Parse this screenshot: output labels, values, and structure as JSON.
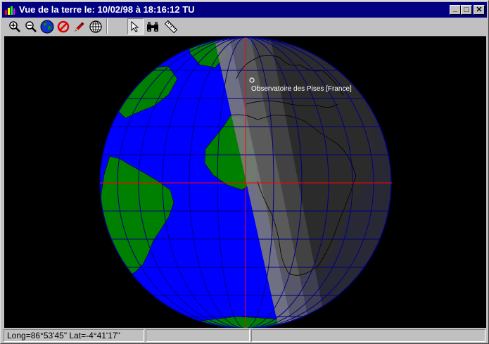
{
  "window": {
    "title": "Vue de la terre le: 10/02/98 à 18:16:12 TU",
    "controls": {
      "minimize": "_",
      "maximize": "□",
      "close": "✕"
    }
  },
  "toolbar": {
    "buttons": [
      {
        "id": "zoom-in",
        "icon": "magnifier-plus-icon"
      },
      {
        "id": "zoom-out",
        "icon": "magnifier-minus-icon"
      },
      {
        "id": "globe-view",
        "icon": "globe-icon"
      },
      {
        "id": "stop",
        "icon": "no-entry-icon"
      },
      {
        "id": "pencil",
        "icon": "pencil-icon"
      },
      {
        "id": "grid",
        "icon": "wireframe-globe-icon"
      },
      {
        "id": "select",
        "icon": "arrow-cursor-icon",
        "pressed": true
      },
      {
        "id": "binoculars",
        "icon": "binoculars-icon"
      },
      {
        "id": "ruler",
        "icon": "ruler-icon"
      }
    ]
  },
  "map": {
    "observatory_label": "Observatoire des Pises [France]",
    "colors": {
      "ocean": "#0000ff",
      "land": "#008000",
      "night": "#2b2b2b",
      "graticule": "#000080",
      "crosshair": "#ff0000",
      "space": "#000000"
    }
  },
  "status": {
    "coordinates": "Long=86°53'45\" Lat=-4°41'17\"",
    "panel2": "",
    "panel3": ""
  }
}
